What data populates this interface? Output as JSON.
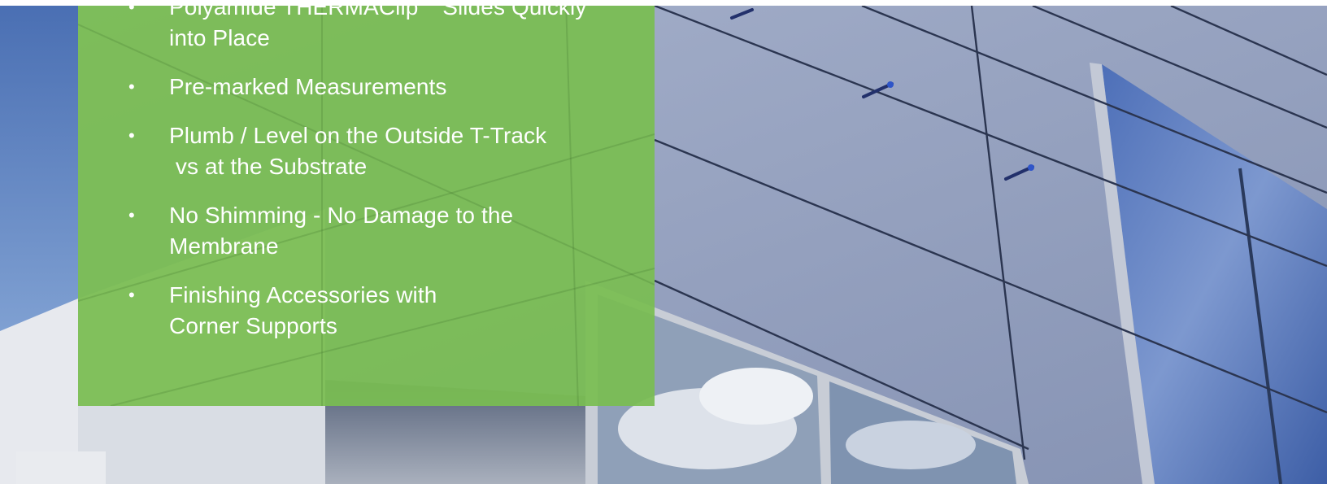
{
  "colors": {
    "panel_green": "#7abd52",
    "text": "#ffffff",
    "facade_panel": "#9aa7c2",
    "glass": "#5f7fbf"
  },
  "feature_list": {
    "items": [
      {
        "lines": [
          "Polyamide THERMAClip",
          "into Place"
        ],
        "trademark": "TM",
        "line1_suffix": " Slides Quickly"
      },
      {
        "lines": [
          "Pre-marked Measurements"
        ]
      },
      {
        "lines": [
          "Plumb / Level on the Outside T-Track",
          " vs at the Substrate"
        ]
      },
      {
        "lines": [
          "No Shimming - No Damage to the",
          "Membrane"
        ]
      },
      {
        "lines": [
          "Finishing Accessories with",
          "Corner Supports"
        ]
      }
    ],
    "bullet_glyph": "•"
  },
  "background": {
    "icon": "building-facade-image"
  }
}
